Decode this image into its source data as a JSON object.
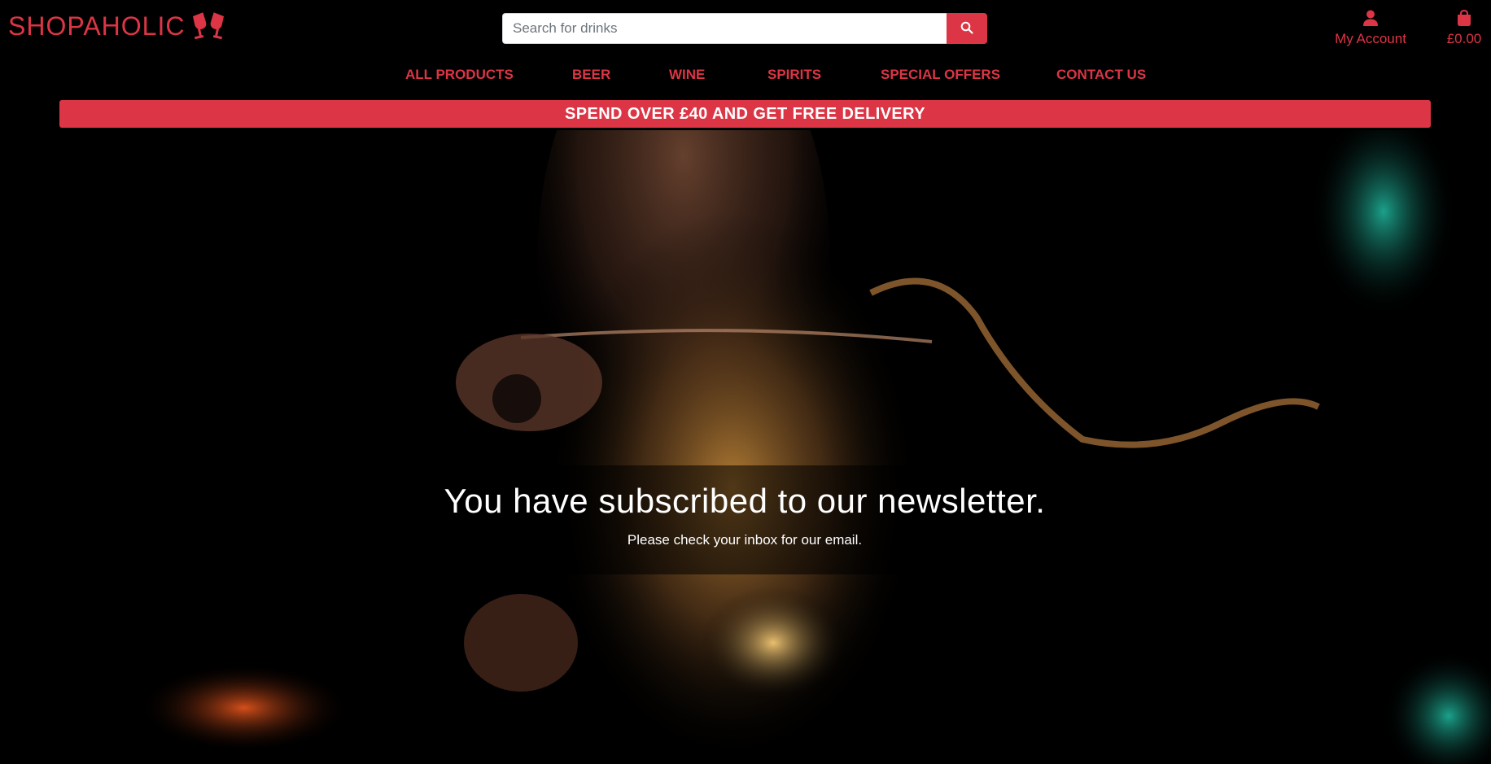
{
  "brand": {
    "name": "SHOPAHOLIC",
    "icon": "glass-cheers-icon",
    "color": "#dc3545"
  },
  "search": {
    "placeholder": "Search for drinks",
    "value": "",
    "button_icon": "search-icon"
  },
  "account": {
    "icon": "user-icon",
    "label": "My Account"
  },
  "bag": {
    "icon": "shopping-bag-icon",
    "total": "£0.00"
  },
  "nav": {
    "items": [
      {
        "label": "ALL PRODUCTS"
      },
      {
        "label": "BEER"
      },
      {
        "label": "WINE"
      },
      {
        "label": "SPIRITS"
      },
      {
        "label": "SPECIAL OFFERS"
      },
      {
        "label": "CONTACT US"
      }
    ]
  },
  "banner": {
    "text": "SPEND OVER £40 AND GET FREE DELIVERY"
  },
  "message": {
    "title": "You have subscribed to our newsletter.",
    "subtitle": "Please check your inbox for our email."
  },
  "colors": {
    "accent": "#dc3545",
    "background": "#000000",
    "text_light": "#ffffff"
  }
}
